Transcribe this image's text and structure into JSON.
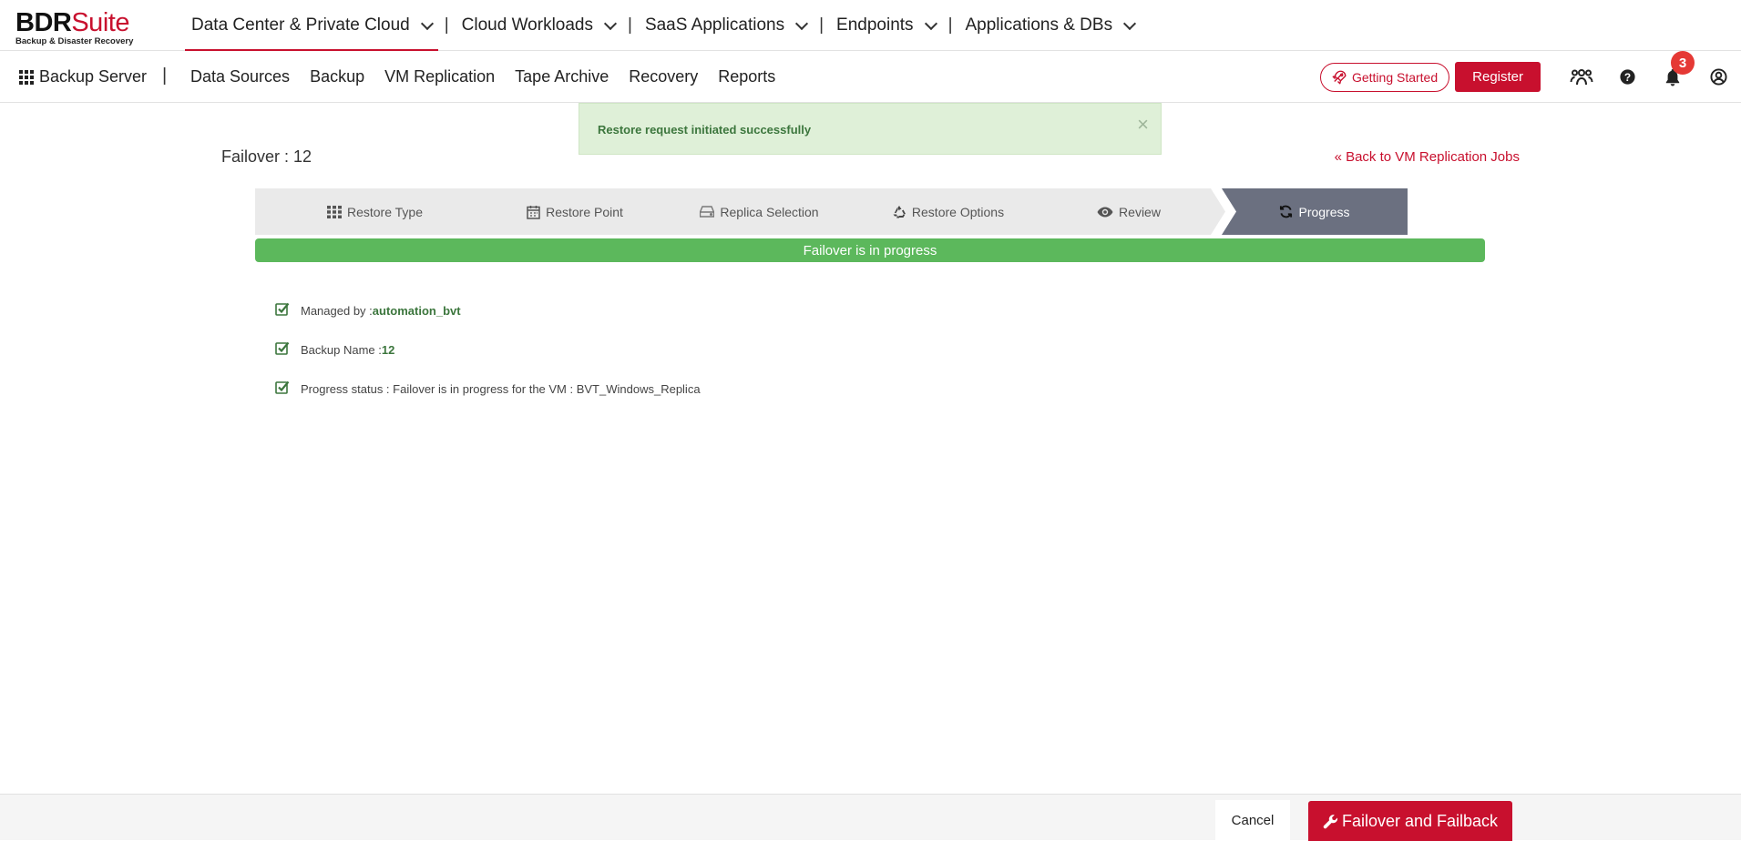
{
  "brand": {
    "name_bold": "BDR",
    "name_thin": "Suite",
    "tagline": "Backup & Disaster Recovery"
  },
  "topnav": [
    {
      "label": "Data Center & Private Cloud",
      "active": true
    },
    {
      "label": "Cloud Workloads"
    },
    {
      "label": "SaaS Applications"
    },
    {
      "label": "Endpoints"
    },
    {
      "label": "Applications & DBs"
    }
  ],
  "topnav_separator": "|",
  "app": {
    "name": "Backup Server",
    "separator": "|"
  },
  "subnav": [
    "Data Sources",
    "Backup",
    "VM Replication",
    "Tape Archive",
    "Recovery",
    "Reports"
  ],
  "toolbar": {
    "getting_started": "Getting Started",
    "register": "Register",
    "notification_count": "3"
  },
  "alert": {
    "message": "Restore request initiated successfully",
    "close": "×"
  },
  "page": {
    "title": "Failover : 12",
    "back_link": "« Back to VM Replication Jobs"
  },
  "wizard": {
    "steps": [
      {
        "label": "Restore Type",
        "icon": "grid-icon"
      },
      {
        "label": "Restore Point",
        "icon": "calendar-icon"
      },
      {
        "label": "Replica Selection",
        "icon": "hdd-icon"
      },
      {
        "label": "Restore Options",
        "icon": "recycle-icon"
      },
      {
        "label": "Review",
        "icon": "eye-icon"
      },
      {
        "label": "Progress",
        "icon": "refresh-icon",
        "active": true
      }
    ]
  },
  "progress": {
    "label": "Failover is in progress",
    "percent": 100,
    "color": "#5cb85c"
  },
  "details": [
    {
      "label": "Managed by : ",
      "value": "automation_bvt"
    },
    {
      "label": "Backup Name : ",
      "value": "12"
    },
    {
      "label": "Progress status : Failover is in progress for the VM : BVT_Windows_Replica",
      "value": ""
    }
  ],
  "footer": {
    "cancel": "Cancel",
    "primary": "Failover and Failback"
  },
  "colors": {
    "accent": "#c8102e",
    "success": "#5cb85c",
    "active_step": "#6b7080"
  }
}
